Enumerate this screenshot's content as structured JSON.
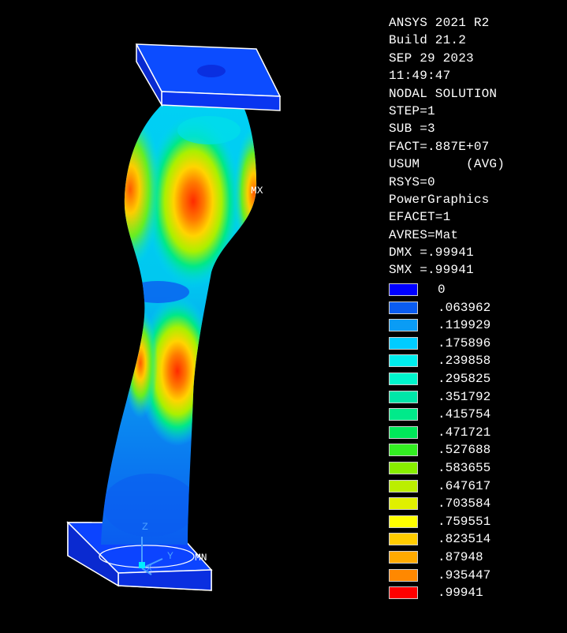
{
  "info": {
    "lines": [
      "ANSYS 2021 R2",
      "Build 21.2",
      "SEP 29 2023",
      "11:49:47",
      "NODAL SOLUTION",
      "STEP=1",
      "SUB =3",
      "FACT=.887E+07",
      "USUM      (AVG)",
      "RSYS=0",
      "PowerGraphics",
      "EFACET=1",
      "AVRES=Mat",
      "DMX =.99941",
      "SMX =.99941"
    ]
  },
  "legend": {
    "entries": [
      {
        "label": "0",
        "color": "#0000ff"
      },
      {
        "label": ".063962",
        "color": "#0a5cf0"
      },
      {
        "label": ".119929",
        "color": "#0a9cf5"
      },
      {
        "label": ".175896",
        "color": "#00ccff"
      },
      {
        "label": ".239858",
        "color": "#00eeee"
      },
      {
        "label": ".295825",
        "color": "#00f5cc"
      },
      {
        "label": ".351792",
        "color": "#00e6a8"
      },
      {
        "label": ".415754",
        "color": "#00ea8a"
      },
      {
        "label": ".471721",
        "color": "#00e85a"
      },
      {
        "label": ".527688",
        "color": "#33ee22"
      },
      {
        "label": ".583655",
        "color": "#88ee00"
      },
      {
        "label": ".647617",
        "color": "#bbee00"
      },
      {
        "label": ".703584",
        "color": "#e0f000"
      },
      {
        "label": ".759551",
        "color": "#ffff00"
      },
      {
        "label": ".823514",
        "color": "#ffcc00"
      },
      {
        "label": ".87948",
        "color": "#ffaa00"
      },
      {
        "label": ".935447",
        "color": "#ff8800"
      },
      {
        "label": ".99941",
        "color": "#ff0000"
      }
    ]
  },
  "markers": {
    "max": "MX",
    "min": "MN"
  },
  "triad": {
    "z": "Z",
    "y": "Y",
    "x": "X"
  }
}
